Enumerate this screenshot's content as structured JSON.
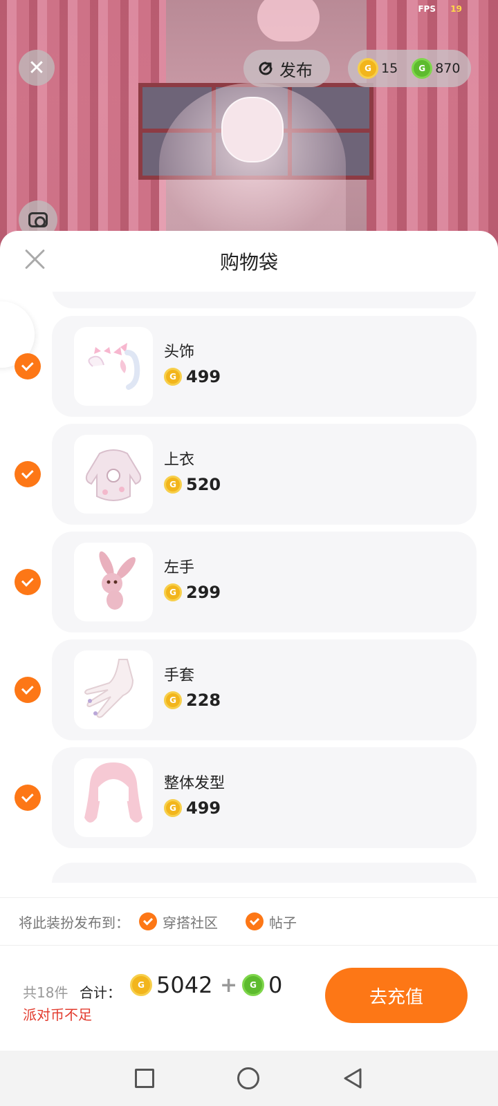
{
  "hud": {
    "fps_label": "FPS",
    "fps_value": "19"
  },
  "top_bar": {
    "publish_label": "发布",
    "currency_gold": "15",
    "currency_green": "870"
  },
  "colors": {
    "accent": "#fd7716",
    "gold_coin": "#f2b51c",
    "green_coin": "#5dbb2e",
    "warning": "#e23b2e"
  },
  "sheet": {
    "title": "购物袋",
    "items": [
      {
        "name": "头饰",
        "price": "499",
        "checked": true,
        "thumb_icon": "bow-headpiece-icon"
      },
      {
        "name": "上衣",
        "price": "520",
        "checked": true,
        "thumb_icon": "sweater-icon"
      },
      {
        "name": "左手",
        "price": "299",
        "checked": true,
        "thumb_icon": "bunny-plush-icon"
      },
      {
        "name": "手套",
        "price": "228",
        "checked": true,
        "thumb_icon": "glove-icon"
      },
      {
        "name": "整体发型",
        "price": "499",
        "checked": true,
        "thumb_icon": "hairstyle-icon"
      }
    ]
  },
  "publish": {
    "label": "将此装扮发布到：",
    "options": [
      "穿搭社区",
      "帖子"
    ]
  },
  "checkout": {
    "count": "共18件",
    "total_label": "合计：",
    "gold_total": "5042",
    "plus": "+",
    "green_total": "0",
    "warning": "派对币不足",
    "recharge_label": "去充值"
  }
}
